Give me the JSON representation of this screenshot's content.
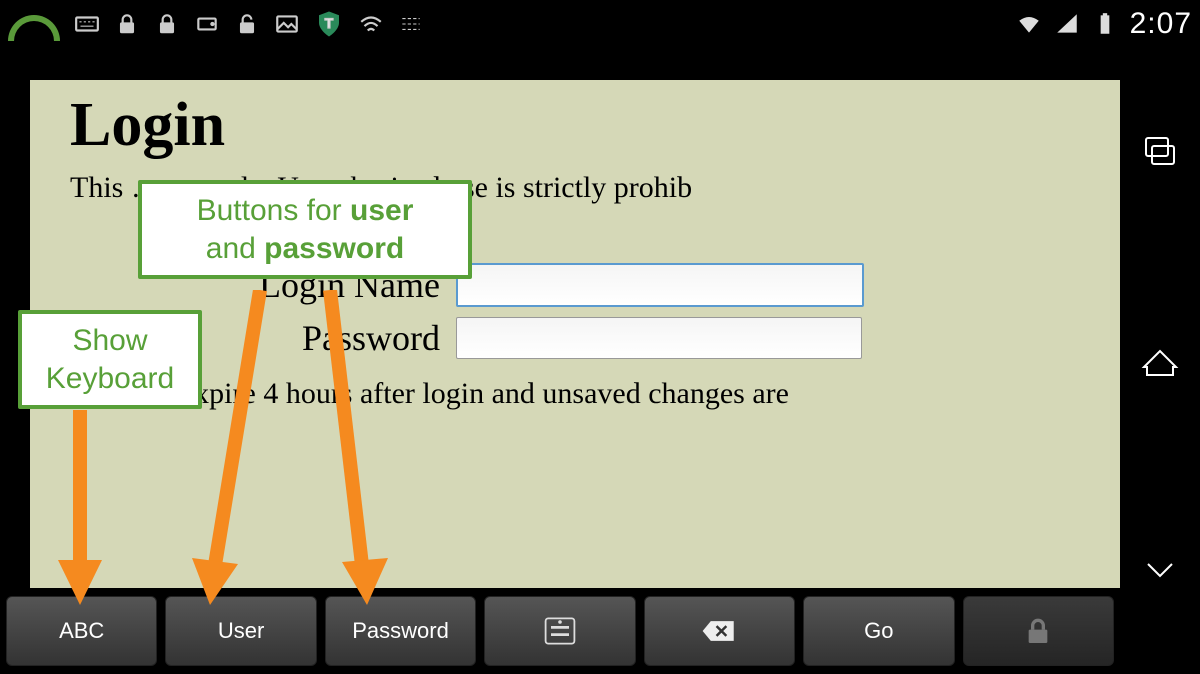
{
  "statusbar": {
    "time": "2:07"
  },
  "page": {
    "title": "Login",
    "notice": "This … ers only. Unauthorized use is strictly prohib",
    "login_name_label": "Login Name",
    "password_label": "Password",
    "session_note": "Sessions expire 4 hours after login and unsaved changes are"
  },
  "toolbar": {
    "abc": "ABC",
    "user": "User",
    "password": "Password",
    "go": "Go"
  },
  "annotations": {
    "show_keyboard": "Show Keyboard",
    "user_pwd_line1_a": "Buttons for ",
    "user_pwd_line1_b": "user",
    "user_pwd_line2_a": "and ",
    "user_pwd_line2_b": "password"
  }
}
